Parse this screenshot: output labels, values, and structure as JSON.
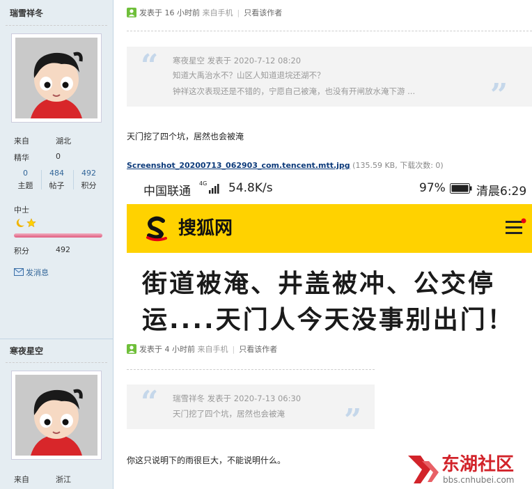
{
  "users": [
    {
      "name": "瑞雪祥冬",
      "from_label": "来自",
      "from_value": "湖北",
      "digest_label": "精华",
      "digest_value": "0",
      "stats": [
        {
          "n": "0",
          "t": "主题"
        },
        {
          "n": "484",
          "t": "帖子"
        },
        {
          "n": "492",
          "t": "积分"
        }
      ],
      "rank": "中士",
      "points_label": "积分",
      "points_value": "492",
      "message": "发消息"
    },
    {
      "name": "寒夜星空",
      "from_label": "来自",
      "from_value": "浙江"
    }
  ],
  "posts": [
    {
      "meta": {
        "posted": "发表于 16 小时前",
        "source": "来自手机",
        "sep": "|",
        "only_author": "只看该作者"
      },
      "quote": {
        "author_line": "寒夜星空 发表于 2020-7-12 08:20",
        "line1": "知道大禹治水不？山区人知道退垸还湖不？",
        "line2": "钟祥这次表现还是不错的，宁愿自己被淹，也没有开闸放水淹下游 ..."
      },
      "text": "天门挖了四个坑，居然也会被淹",
      "attachment": {
        "filename": "Screenshot_20200713_062903_com.tencent.mtt.jpg",
        "info": "(135.59 KB, 下载次数: 0)"
      },
      "screenshot": {
        "carrier": "中国联通",
        "net": "4G",
        "speed": "54.8K/s",
        "battery": "97%",
        "time": "清晨6:29",
        "site": "搜狐网",
        "headline1": "街道被淹、井盖被冲、公交停",
        "headline2": "运....天门人今天没事别出门！"
      }
    },
    {
      "meta": {
        "posted": "发表于 4 小时前",
        "source": "来自手机",
        "sep": "|",
        "only_author": "只看该作者"
      },
      "quote": {
        "author_line": "瑞雪祥冬 发表于 2020-7-13 06:30",
        "line1": "天门挖了四个坑，居然也会被淹"
      },
      "text": "你这只说明下的雨很巨大，不能说明什么。"
    }
  ],
  "watermark": {
    "name": "东湖社区",
    "url": "bbs.cnhubei.com"
  },
  "colors": {
    "sidebar": "#e5edf2",
    "link": "#336699",
    "yellow": "#ffd200",
    "watermark": "#d2232a"
  }
}
